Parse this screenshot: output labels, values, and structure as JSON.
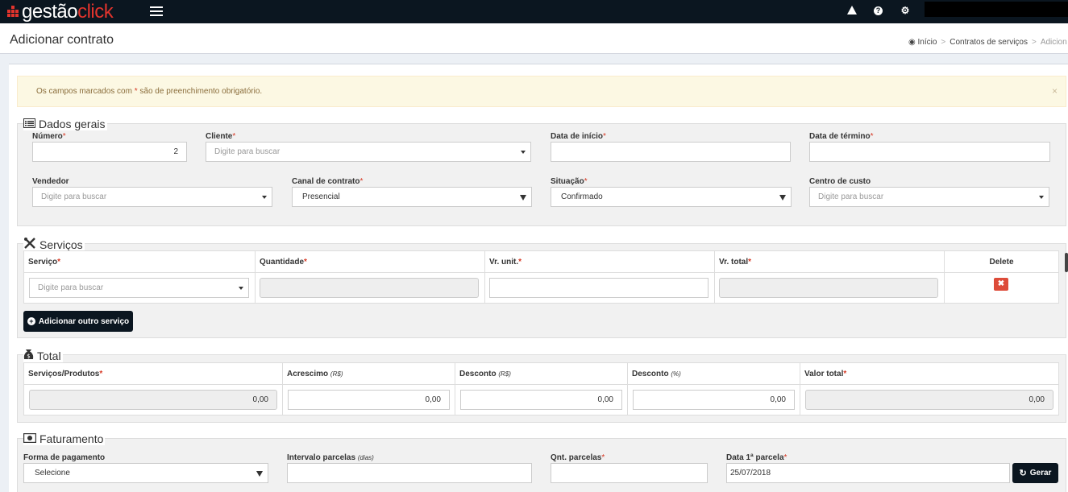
{
  "app": {
    "logo_prefix": "gestão",
    "logo_suffix": "click",
    "brand_color": "#e2342d",
    "topbar_icons": [
      "warning-icon",
      "question-icon",
      "cogs-icon"
    ]
  },
  "page": {
    "title": "Adicionar contrato",
    "breadcrumb": [
      "Início",
      "Contratos de serviços",
      "Adicion"
    ]
  },
  "alert": {
    "text_before": "Os campos marcados com ",
    "marker": "*",
    "text_after": " são de preenchimento obrigatório.",
    "close": "×"
  },
  "dados_gerais": {
    "legend": "Dados gerais",
    "numero": {
      "label": "Número",
      "value": "2"
    },
    "cliente": {
      "label": "Cliente",
      "placeholder": "Digite para buscar"
    },
    "data_inicio": {
      "label": "Data de início",
      "value": ""
    },
    "data_termino": {
      "label": "Data de término",
      "value": ""
    },
    "vendedor": {
      "label": "Vendedor",
      "placeholder": "Digite para buscar"
    },
    "canal": {
      "label": "Canal de contrato",
      "value": "Presencial"
    },
    "situacao": {
      "label": "Situação",
      "value": "Confirmado"
    },
    "centro": {
      "label": "Centro de custo",
      "placeholder": "Digite para buscar"
    }
  },
  "servicos": {
    "legend": "Serviços",
    "columns": {
      "servico": "Serviço",
      "quantidade": "Quantidade",
      "vr_unit": "Vr. unit.",
      "vr_total": "Vr. total",
      "delete": "Delete"
    },
    "row": {
      "servico_placeholder": "Digite para buscar",
      "quantidade": "",
      "vr_unit": "",
      "vr_total": ""
    },
    "delete_glyph": "✖",
    "add_button": "Adicionar outro serviço"
  },
  "total": {
    "legend": "Total",
    "columns": {
      "servicos": "Serviços/Produtos",
      "acrescimo": "Acrescimo",
      "acrescimo_unit": "(R$)",
      "desconto": "Desconto",
      "desconto_unit": "(R$)",
      "desconto_pct": "Desconto",
      "desconto_pct_unit": "(%)",
      "valor_total": "Valor total"
    },
    "values": {
      "servicos": "0,00",
      "acrescimo": "0,00",
      "desconto": "0,00",
      "desconto_pct": "0,00",
      "valor_total": "0,00"
    }
  },
  "faturamento": {
    "legend": "Faturamento",
    "forma": {
      "label": "Forma de pagamento",
      "value": "Selecione"
    },
    "intervalo": {
      "label": "Intervalo parcelas",
      "unit": "(dias)",
      "value": ""
    },
    "qnt": {
      "label": "Qnt. parcelas",
      "value": ""
    },
    "data1": {
      "label": "Data 1ª parcela",
      "value": "25/07/2018"
    },
    "gerar_button": "Gerar"
  }
}
